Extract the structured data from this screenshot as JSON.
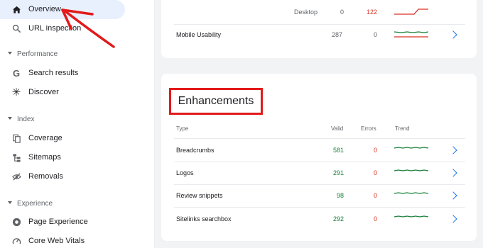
{
  "sidebar": {
    "nav_top": [
      {
        "label": "Overview",
        "icon": "home-icon",
        "active": true
      },
      {
        "label": "URL inspection",
        "icon": "search-icon",
        "active": false
      }
    ],
    "sections": [
      {
        "label": "Performance",
        "items": [
          {
            "label": "Search results",
            "icon": "google-icon"
          },
          {
            "label": "Discover",
            "icon": "asterisk-icon"
          }
        ]
      },
      {
        "label": "Index",
        "items": [
          {
            "label": "Coverage",
            "icon": "coverage-icon"
          },
          {
            "label": "Sitemaps",
            "icon": "sitemap-icon"
          },
          {
            "label": "Removals",
            "icon": "eye-off-icon"
          }
        ]
      },
      {
        "label": "Experience",
        "items": [
          {
            "label": "Page Experience",
            "icon": "page-experience-icon"
          },
          {
            "label": "Core Web Vitals",
            "icon": "speed-icon"
          }
        ]
      }
    ]
  },
  "experience_card": {
    "desktop_row": {
      "label": "Desktop",
      "good": "0",
      "poor": "122"
    },
    "mobile_row": {
      "label": "Mobile Usability",
      "valid": "287",
      "errors": "0"
    }
  },
  "enhancements": {
    "title": "Enhancements",
    "columns": {
      "type": "Type",
      "valid": "Valid",
      "errors": "Errors",
      "trend": "Trend"
    },
    "rows": [
      {
        "type": "Breadcrumbs",
        "valid": "581",
        "errors": "0"
      },
      {
        "type": "Logos",
        "valid": "291",
        "errors": "0"
      },
      {
        "type": "Review snippets",
        "valid": "98",
        "errors": "0"
      },
      {
        "type": "Sitelinks searchbox",
        "valid": "292",
        "errors": "0"
      }
    ]
  },
  "colors": {
    "accent": "#1a73e8",
    "valid_green": "#188038",
    "error_red": "#d93025",
    "annotation_red": "#e21a1a",
    "active_bg": "#e8f0fe"
  }
}
